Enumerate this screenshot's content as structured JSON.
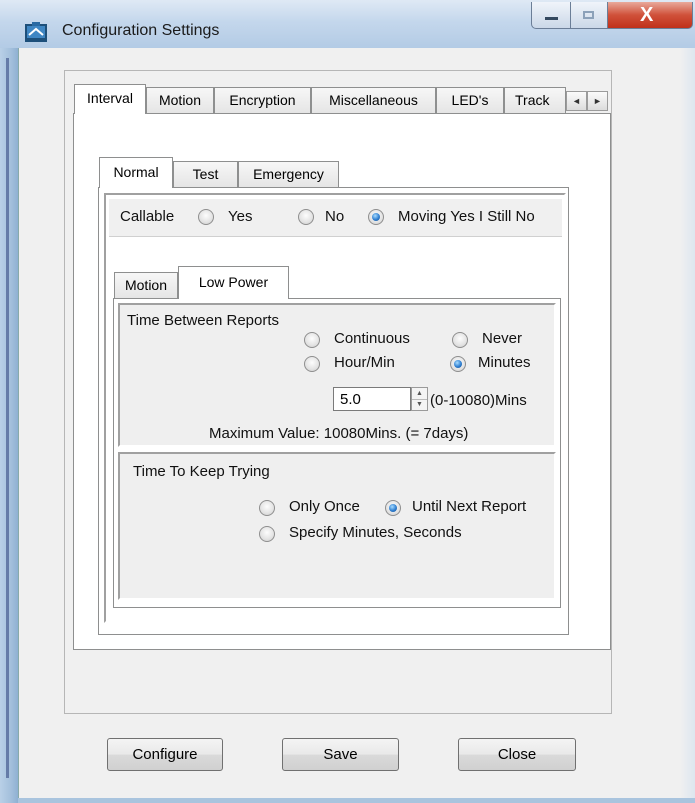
{
  "window": {
    "title": "Configuration Settings",
    "app_icon": "app-icon"
  },
  "caption": {
    "minimize_icon": "minimize-icon",
    "maximize_icon": "maximize-icon",
    "close_glyph": "X"
  },
  "top_tabs": [
    "Interval",
    "Motion",
    "Encryption",
    "Miscellaneous",
    "LED's",
    "Track"
  ],
  "top_tabs_active": "Interval",
  "tab_scroll": {
    "left": "◄",
    "right": "►"
  },
  "mode_tabs": [
    "Normal",
    "Test",
    "Emergency"
  ],
  "mode_tabs_active": "Normal",
  "callable": {
    "label": "Callable",
    "options": [
      "Yes",
      "No",
      "Moving Yes I Still No"
    ],
    "selected": "Moving Yes I Still No"
  },
  "power_tabs": [
    "Motion",
    "Low Power"
  ],
  "power_tabs_active": "Low Power",
  "time_between_reports": {
    "heading": "Time Between Reports",
    "options": [
      "Continuous",
      "Never",
      "Hour/Min",
      "Minutes"
    ],
    "selected": "Minutes",
    "value": "5.0",
    "range_label": "(0-10080)Mins",
    "max_note": "Maximum Value: 10080Mins. (= 7days)"
  },
  "time_to_keep_trying": {
    "heading": "Time To Keep Trying",
    "options": [
      "Only Once",
      "Until Next Report",
      "Specify Minutes, Seconds"
    ],
    "selected": "Until Next Report"
  },
  "buttons": {
    "configure": "Configure",
    "save": "Save",
    "close": "Close"
  }
}
